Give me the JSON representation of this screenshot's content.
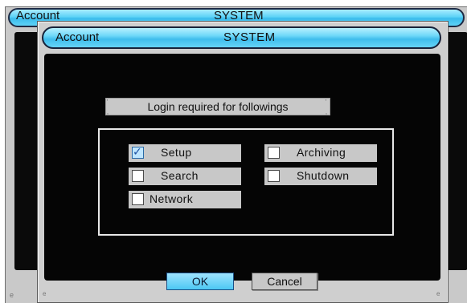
{
  "back_window": {
    "title_left": "Account",
    "title_center": "SYSTEM"
  },
  "dialog": {
    "title_left": "Account",
    "title_center": "SYSTEM",
    "login_label": "Login required for followings",
    "options": [
      {
        "label": "Setup",
        "checked": true
      },
      {
        "label": "Archiving",
        "checked": false
      },
      {
        "label": "Search",
        "checked": false
      },
      {
        "label": "Shutdown",
        "checked": false
      },
      {
        "label": "Network",
        "checked": false
      }
    ],
    "buttons": {
      "ok": "OK",
      "cancel": "Cancel"
    }
  },
  "colors": {
    "titlebar_accent": "#4cc8f2",
    "content_background": "#050505",
    "panel_gray": "#c8c8c8"
  },
  "icons": {
    "checkbox_checked": "check-icon"
  }
}
